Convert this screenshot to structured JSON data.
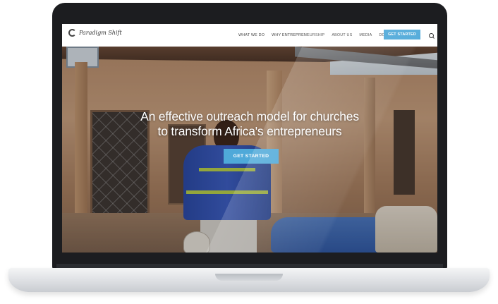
{
  "site": {
    "brand": "Paradigm Shift"
  },
  "nav": {
    "items": [
      {
        "label": "WHAT WE DO"
      },
      {
        "label": "WHY ENTREPRENEURSHIP"
      },
      {
        "label": "ABOUT US"
      },
      {
        "label": "MEDIA"
      },
      {
        "label": "DONATE"
      }
    ],
    "cta_label": "GET STARTED",
    "search_icon": "search-icon"
  },
  "hero": {
    "headline_line1": "An effective outreach model for churches",
    "headline_line2": "to transform Africa's entrepreneurs",
    "cta_label": "GET STARTED"
  },
  "colors": {
    "accent": "#4fa9d9",
    "nav_background": "#ffffff",
    "hero_text": "#ffffff"
  }
}
